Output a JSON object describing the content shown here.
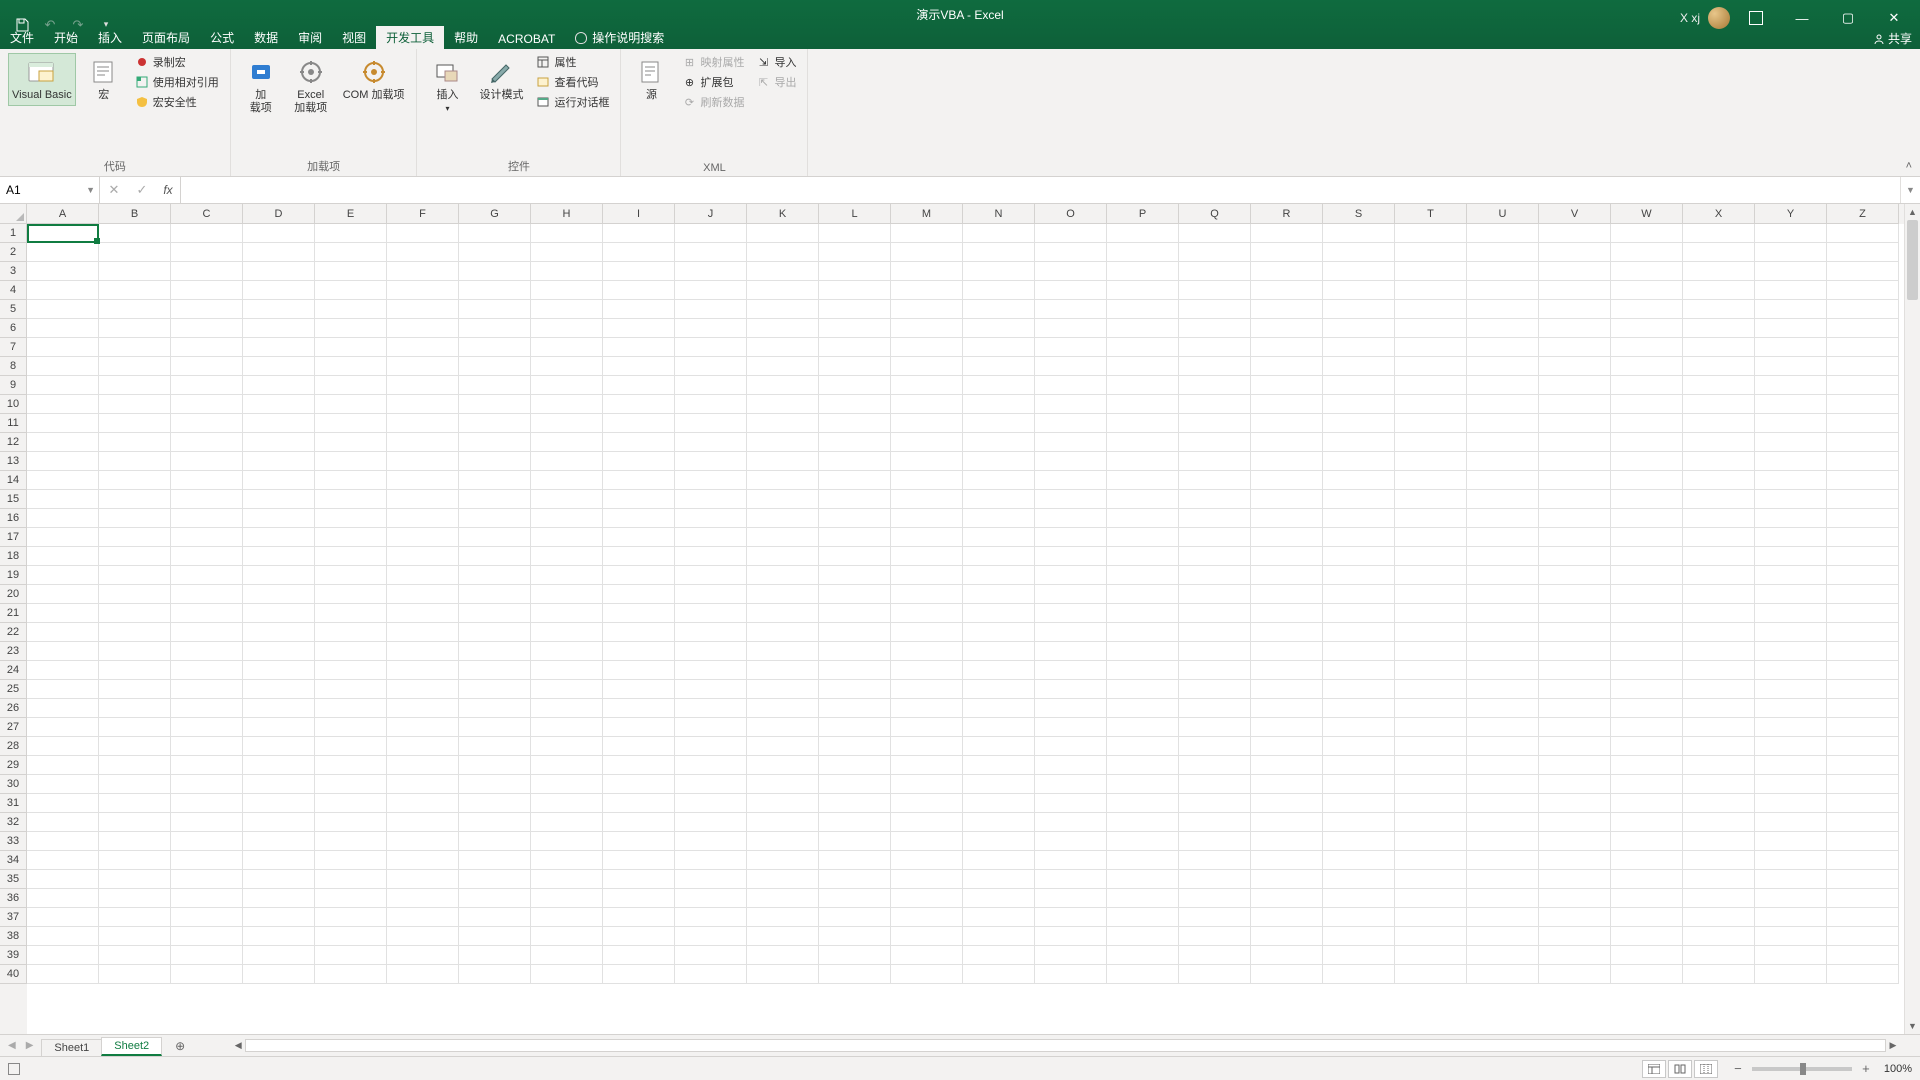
{
  "title": "演示VBA - Excel",
  "user": "X xj",
  "share": "共享",
  "tabs": [
    "文件",
    "开始",
    "插入",
    "页面布局",
    "公式",
    "数据",
    "审阅",
    "视图",
    "开发工具",
    "帮助",
    "ACROBAT"
  ],
  "active_tab_index": 8,
  "tell_me": "操作说明搜索",
  "ribbon": {
    "code": {
      "visual_basic": "Visual Basic",
      "macros": "宏",
      "record_macro": "录制宏",
      "use_relative": "使用相对引用",
      "macro_security": "宏安全性",
      "group": "代码"
    },
    "addins": {
      "addins": "加载项",
      "excel_addins": "Excel\n加载项",
      "com_addins": "COM 加载项",
      "group": "加载项"
    },
    "controls": {
      "insert": "插入",
      "design_mode": "设计模式",
      "properties": "属性",
      "view_code": "查看代码",
      "run_dialog": "运行对话框",
      "group": "控件"
    },
    "xml": {
      "source": "源",
      "map_props": "映射属性",
      "expansion": "扩展包",
      "refresh": "刷新数据",
      "import": "导入",
      "export": "导出",
      "group": "XML"
    }
  },
  "namebox": "A1",
  "formula": "",
  "columns": [
    "A",
    "B",
    "C",
    "D",
    "E",
    "F",
    "G",
    "H",
    "I",
    "J",
    "K",
    "L",
    "M",
    "N",
    "O",
    "P",
    "Q",
    "R",
    "S",
    "T",
    "U",
    "V",
    "W",
    "X",
    "Y",
    "Z"
  ],
  "rows": [
    1,
    2,
    3,
    4,
    5,
    6,
    7,
    8,
    9,
    10,
    11,
    12,
    13,
    14,
    15,
    16,
    17,
    18,
    19,
    20,
    21,
    22,
    23,
    24,
    25,
    26,
    27,
    28,
    29,
    30,
    31,
    32,
    33,
    34,
    35,
    36,
    37,
    38,
    39,
    40
  ],
  "sheets": [
    "Sheet1",
    "Sheet2"
  ],
  "active_sheet_index": 1,
  "zoom": "100%"
}
